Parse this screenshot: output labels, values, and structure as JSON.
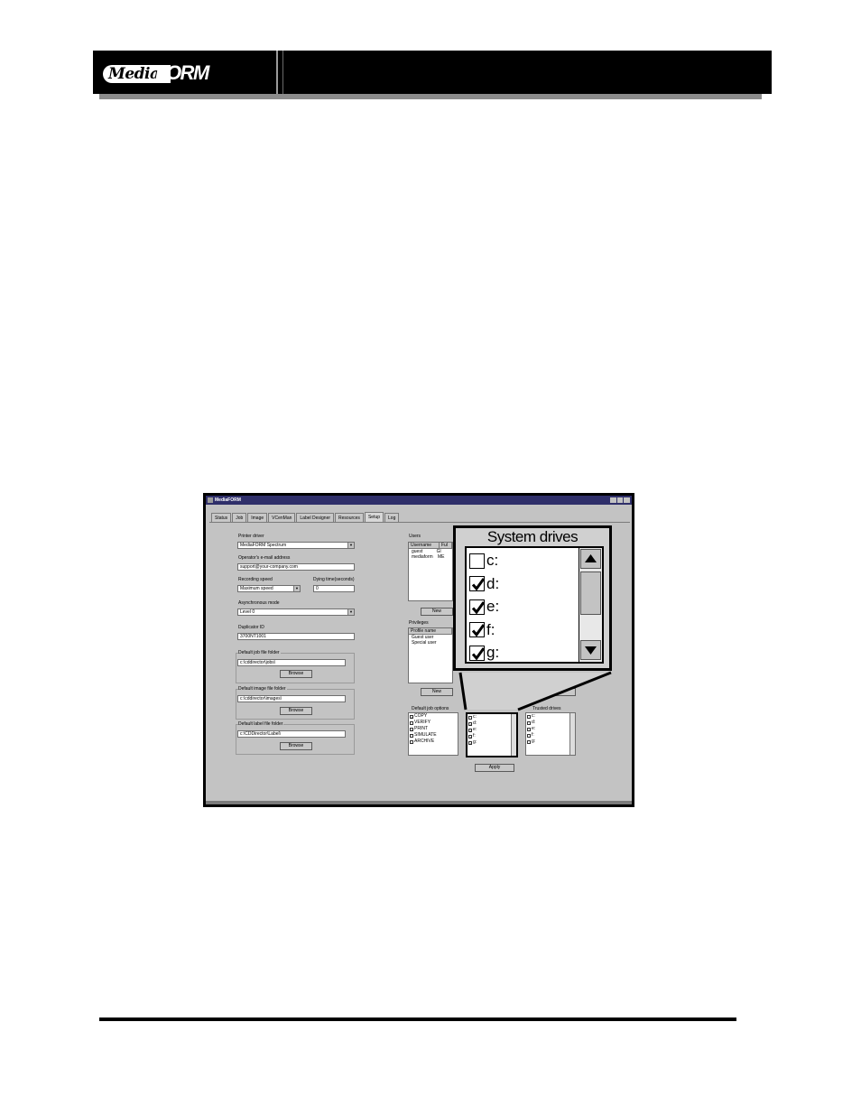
{
  "header": {
    "logo_media": "Media",
    "logo_form": "FORM"
  },
  "app": {
    "window_title": "MediaFORM",
    "tabs": [
      "Status",
      "Job",
      "Image",
      "VCenMan",
      "Label Designer",
      "Resources",
      "Setup",
      "Log"
    ],
    "active_tab": "Setup",
    "printer_driver_label": "Printer driver",
    "printer_driver_value": "MediaFORM Spectrum",
    "operator_email_label": "Operator's e-mail address",
    "operator_email_value": "support@your-company.com",
    "recording_speed_label": "Recording speed",
    "recording_speed_value": "Maximum speed",
    "dying_time_label": "Dying time(seconds)",
    "dying_time_value": "0",
    "asynchronous_mode_label": "Asynchronous mode",
    "asynchronous_mode_value": "Level 0",
    "duplicator_id_label": "Duplicator ID",
    "duplicator_id_value": "3700NT1001",
    "job_folder_label": "Default job file folder",
    "job_folder_value": "c:\\cddirector\\jobs\\",
    "image_folder_label": "Default image file folder",
    "image_folder_value": "c:\\cddirector\\images\\",
    "label_folder_label": "Default label file folder",
    "label_folder_value": "c:\\CDDirector\\Label\\",
    "browse_label": "Browse",
    "users_label": "Users",
    "users_columns": [
      "Username",
      "Ful"
    ],
    "users_rows": [
      [
        "guest",
        "Gl"
      ],
      [
        "mediaform",
        "ME"
      ]
    ],
    "new_label": "New",
    "privileges_label": "Privileges",
    "privileges_columns": [
      "Profile name"
    ],
    "privileges_rows": [
      "Guest user",
      "Special user"
    ],
    "edit_label": "Edit",
    "delete_label": "Delete",
    "job_options_label": "Default job options",
    "job_options": [
      {
        "label": "COPY",
        "checked": true
      },
      {
        "label": "VERIFY",
        "checked": false
      },
      {
        "label": "PRINT",
        "checked": true
      },
      {
        "label": "SIMULATE",
        "checked": false
      },
      {
        "label": "ARCHIVE",
        "checked": false
      }
    ],
    "system_drives_small": [
      {
        "label": "c:",
        "checked": false
      },
      {
        "label": "d:",
        "checked": true
      },
      {
        "label": "e:",
        "checked": true
      },
      {
        "label": "f:",
        "checked": true
      },
      {
        "label": "g:",
        "checked": true
      }
    ],
    "trusted_drives_label": "Trusted drives",
    "trusted_drives": [
      "c:",
      "d:",
      "e:",
      "f:",
      "g:"
    ],
    "apply_label": "Apply"
  },
  "zoom": {
    "title": "System drives",
    "drives": [
      {
        "label": "c:",
        "checked": false
      },
      {
        "label": "d:",
        "checked": true
      },
      {
        "label": "e:",
        "checked": true
      },
      {
        "label": "f:",
        "checked": true
      },
      {
        "label": "g:",
        "checked": true
      }
    ]
  }
}
